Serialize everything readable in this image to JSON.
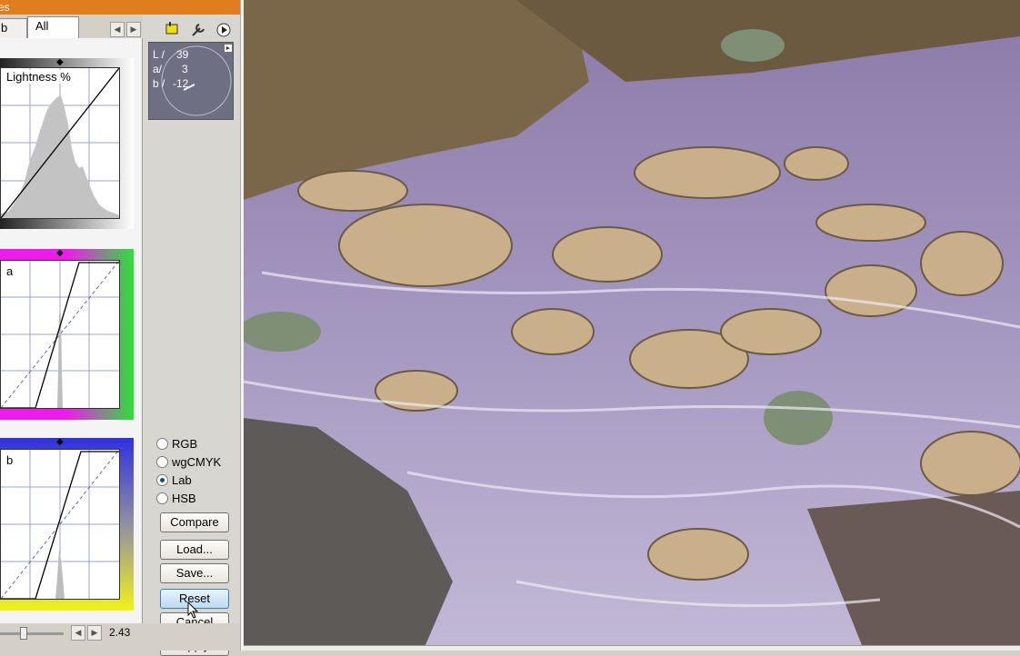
{
  "window": {
    "title_fragment": "es"
  },
  "tabs": [
    {
      "label": "b",
      "active": false
    },
    {
      "label": "All",
      "active": true
    }
  ],
  "nav": {
    "prev": "◀",
    "next": "▶"
  },
  "curves": [
    {
      "label": "Lightness %"
    },
    {
      "label": "a"
    },
    {
      "label": "b"
    }
  ],
  "readout": {
    "l_label": "L /",
    "l_value": "39",
    "a_label": "a/",
    "a_value": "3",
    "b_label": "b /",
    "b_value": "-12"
  },
  "tools": {
    "sample": "sampler-icon",
    "settings": "wrench-icon",
    "menu": "play-icon"
  },
  "modes": [
    {
      "label": "RGB",
      "selected": false
    },
    {
      "label": "wgCMYK",
      "selected": false
    },
    {
      "label": "Lab",
      "selected": true
    },
    {
      "label": "HSB",
      "selected": false
    }
  ],
  "buttons": {
    "compare": "Compare",
    "load": "Load...",
    "save": "Save...",
    "reset": "Reset",
    "cancel": "Cancel",
    "apply": "Apply"
  },
  "bottom": {
    "value": "2.43"
  },
  "colors": {
    "accent": "#e07e1f",
    "readout_bg": "#6f6f84",
    "hot_button": "#bcd9f1"
  }
}
